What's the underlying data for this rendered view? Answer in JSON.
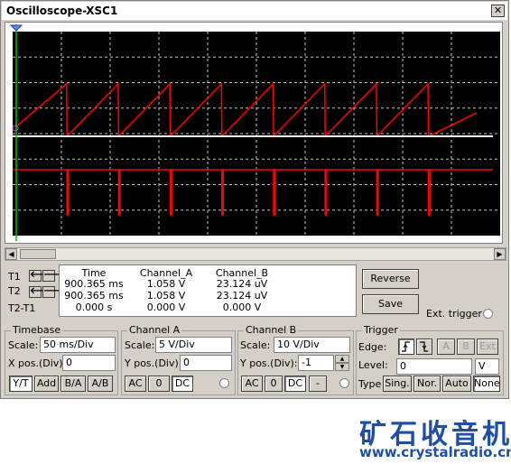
{
  "window": {
    "title": "Oscilloscope-XSC1",
    "close_glyph": "✕"
  },
  "colors": {
    "screen_bg": "#000000",
    "grid": "#c0c0c0",
    "channel_a": "#ff0000",
    "channel_b": "#ffffff",
    "cursor": "#00c000",
    "brand": "#1e4ea8"
  },
  "cursors": {
    "t1_label": "T1",
    "t2_label": "T2",
    "t2t1_label": "T2-T1",
    "left_arrow": "🡐",
    "right_arrow": "🡒"
  },
  "readout": {
    "headers": [
      "Time",
      "Channel_A",
      "Channel_B"
    ],
    "rows": [
      [
        "900.365 ms",
        "1.058 V",
        "23.124 uV"
      ],
      [
        "900.365 ms",
        "1.058 V",
        "23.124 uV"
      ],
      [
        "0.000 s",
        "0.000 V",
        "0.000 V"
      ]
    ]
  },
  "buttons": {
    "reverse": "Reverse",
    "save": "Save",
    "ext_trigger": "Ext. trigger"
  },
  "timebase": {
    "title": "Timebase",
    "scale_label": "Scale:",
    "scale_value": "50 ms/Div",
    "xpos_label": "X pos.(Div):",
    "xpos_value": "0",
    "modes": [
      "Y/T",
      "Add",
      "B/A",
      "A/B"
    ]
  },
  "channel_a": {
    "title": "Channel A",
    "scale_label": "Scale:",
    "scale_value": "5  V/Div",
    "ypos_label": "Y pos.(Div):",
    "ypos_value": "0",
    "coupling": [
      "AC",
      "0",
      "DC"
    ]
  },
  "channel_b": {
    "title": "Channel B",
    "scale_label": "Scale:",
    "scale_value": "10  V/Div",
    "ypos_label": "Y pos.(Div):",
    "ypos_value": "-1",
    "coupling": [
      "AC",
      "0",
      "DC",
      "-"
    ]
  },
  "trigger": {
    "title": "Trigger",
    "edge_label": "Edge:",
    "sources": [
      "A",
      "B",
      "Ext"
    ],
    "level_label": "Level:",
    "level_value": "0",
    "level_unit": "V",
    "type_label": "Type",
    "types": [
      "Sing.",
      "Nor.",
      "Auto",
      "None"
    ]
  },
  "brand": {
    "name": "矿石收音机",
    "url": "www.crystalradio.cn"
  }
}
